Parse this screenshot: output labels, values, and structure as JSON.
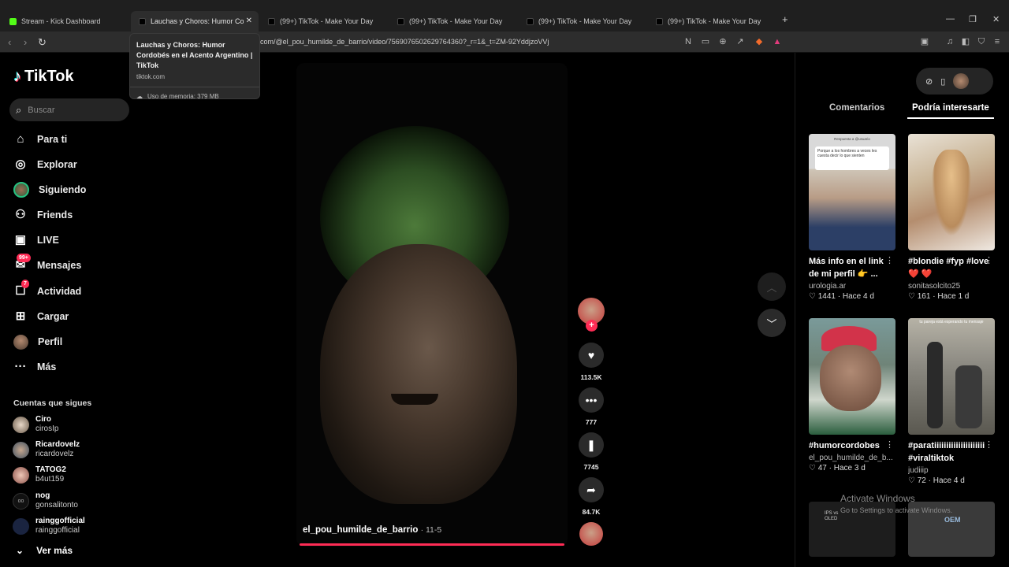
{
  "browser": {
    "tabs": [
      {
        "label": "Stream - Kick Dashboard",
        "favicon": "kick-icon"
      },
      {
        "label": "Lauchas y Choros: Humor Cordo",
        "favicon": "tiktok-icon",
        "active": true
      },
      {
        "label": "(99+) TikTok - Make Your Day",
        "favicon": "tiktok-icon"
      },
      {
        "label": "(99+) TikTok - Make Your Day",
        "favicon": "tiktok-icon"
      },
      {
        "label": "(99+) TikTok - Make Your Day",
        "favicon": "tiktok-icon"
      },
      {
        "label": "(99+) TikTok - Make Your Day",
        "favicon": "tiktok-icon"
      }
    ],
    "new_tab": "+",
    "url": "com/@el_pou_humilde_de_barrio/video/7569076502629764360?_r=1&_t=ZM-92YddjzoVVj",
    "tooltip": {
      "title": "Lauchas y Choros: Humor Cordobés en el Acento Argentino | TikTok",
      "domain": "tiktok.com",
      "memory": "Uso de memoria: 379 MB"
    }
  },
  "sidebar": {
    "brand": "TikTok",
    "search_placeholder": "Buscar",
    "menu": [
      {
        "label": "Para ti",
        "icon": "home-icon"
      },
      {
        "label": "Explorar",
        "icon": "compass-icon"
      },
      {
        "label": "Siguiendo",
        "icon": "following-icon"
      },
      {
        "label": "Friends",
        "icon": "friends-icon"
      },
      {
        "label": "LIVE",
        "icon": "live-icon"
      },
      {
        "label": "Mensajes",
        "icon": "messages-icon",
        "badge": "99+"
      },
      {
        "label": "Actividad",
        "icon": "activity-icon",
        "badge": "7"
      },
      {
        "label": "Cargar",
        "icon": "upload-icon"
      },
      {
        "label": "Perfil",
        "icon": "profile-icon"
      },
      {
        "label": "Más",
        "icon": "more-icon"
      }
    ],
    "following_heading": "Cuentas que sigues",
    "following": [
      {
        "name": "Ciro",
        "handle": "cirosIp"
      },
      {
        "name": "Ricardovelz",
        "handle": "ricardovelz"
      },
      {
        "name": "TATOG2",
        "handle": "b4ut159"
      },
      {
        "name": "nog",
        "handle": "gonsalitonto"
      },
      {
        "name": "rainggofficial",
        "handle": "rainggofficial"
      }
    ],
    "see_more": "Ver más"
  },
  "video": {
    "author": "el_pou_humilde_de_barrio",
    "date": "· 11-5",
    "likes": "113.5K",
    "comments": "777",
    "saves": "7745",
    "shares": "84.7K"
  },
  "right_panel": {
    "tabs": [
      "Comentarios",
      "Podría interesarte"
    ],
    "active_tab": "Podría interesarte",
    "thumb1_text": "Porque a los hombres a veces les cuesta decir lo que sienten",
    "thumb1_header": "Respuesta a @usuario",
    "thumb4_text": "tu pareja está esperando tu mensaje",
    "thumb6_text": "OEM",
    "thumb5_text": "IPS vs OLED",
    "cards": [
      {
        "caption": "Más info en el link de mi perfil 👉 ...",
        "author": "urologia.ar",
        "likes": "1441",
        "time": "Hace 4 d"
      },
      {
        "caption": "#blondie #fyp #love ❤️ ❤️",
        "author": "sonitasolcito25",
        "likes": "161",
        "time": "Hace 1 d"
      },
      {
        "caption": "#humorcordobes",
        "author": "el_pou_humilde_de_b...",
        "likes": "47",
        "time": "Hace 3 d"
      },
      {
        "caption": "#paratiiiiiiiiiiiiiiiiiiiii #viraltiktok",
        "author": "judiiip",
        "likes": "72",
        "time": "Hace 4 d"
      }
    ]
  },
  "os": {
    "activate_title": "Activate Windows",
    "activate_sub": "Go to Settings to activate Windows."
  },
  "colors": {
    "accent": "#fe2c55",
    "kick": "#53fc18"
  }
}
